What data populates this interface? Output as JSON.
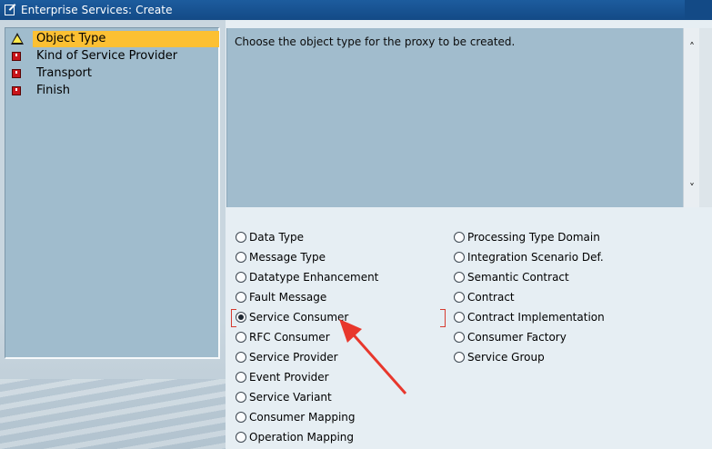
{
  "window": {
    "title": "Enterprise Services: Create"
  },
  "steps": [
    {
      "label": "Object Type",
      "status": "warning",
      "active": true
    },
    {
      "label": "Kind of Service Provider",
      "status": "stop",
      "active": false
    },
    {
      "label": "Transport",
      "status": "stop",
      "active": false
    },
    {
      "label": "Finish",
      "status": "stop",
      "active": false
    }
  ],
  "description": {
    "text": "Choose the object type for the proxy to be created."
  },
  "options_left": [
    {
      "label": "Data Type",
      "checked": false
    },
    {
      "label": "Message Type",
      "checked": false
    },
    {
      "label": "Datatype Enhancement",
      "checked": false
    },
    {
      "label": "Fault Message",
      "checked": false
    },
    {
      "label": "Service Consumer",
      "checked": true
    },
    {
      "label": "RFC Consumer",
      "checked": false
    },
    {
      "label": "Service Provider",
      "checked": false
    },
    {
      "label": "Event Provider",
      "checked": false
    },
    {
      "label": "Service Variant",
      "checked": false
    },
    {
      "label": "Consumer Mapping",
      "checked": false
    },
    {
      "label": "Operation Mapping",
      "checked": false
    }
  ],
  "options_right": [
    {
      "label": "Processing Type Domain",
      "checked": false
    },
    {
      "label": "Integration Scenario Def.",
      "checked": false
    },
    {
      "label": "Semantic Contract",
      "checked": false
    },
    {
      "label": "Contract",
      "checked": false
    },
    {
      "label": "Contract Implementation",
      "checked": false
    },
    {
      "label": "Consumer Factory",
      "checked": false
    },
    {
      "label": "Service Group",
      "checked": false
    }
  ],
  "colors": {
    "titlebar": "#1d5c9e",
    "active_step": "#fcc033",
    "panel": "#a0bccd",
    "annotation_arrow": "#e8372c"
  },
  "icons": {
    "warning": "warning-triangle-icon",
    "stop": "red-stop-icon",
    "scroll_up": "chevron-up-icon",
    "scroll_down": "chevron-down-icon"
  }
}
